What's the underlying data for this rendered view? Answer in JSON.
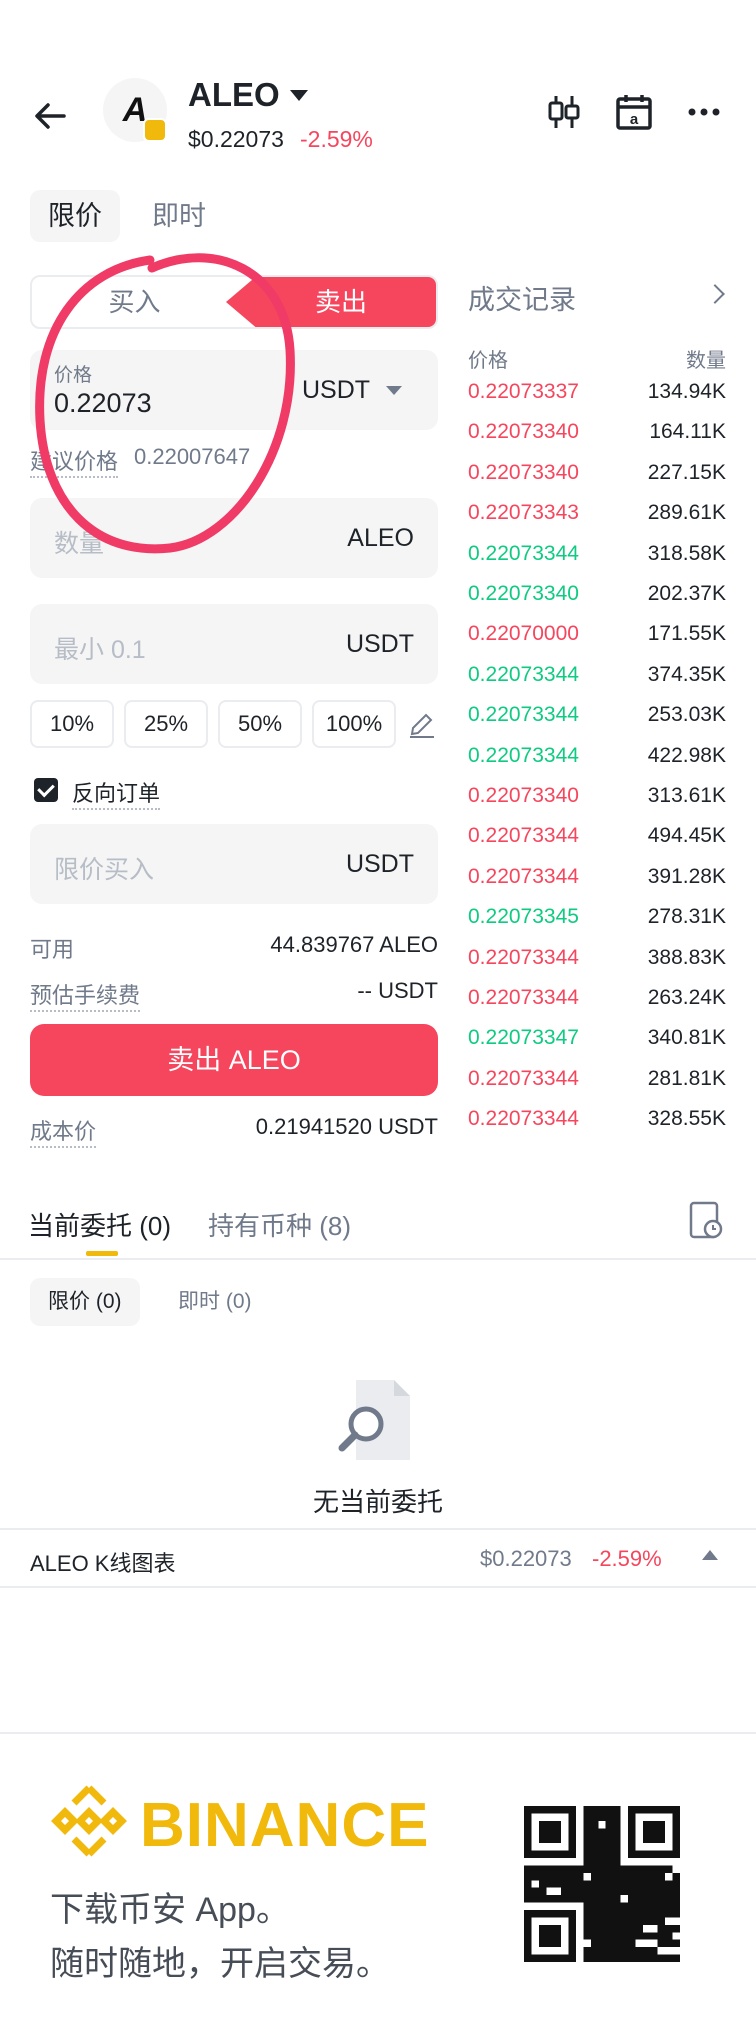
{
  "header": {
    "symbol": "ALEO",
    "price": "$0.22073",
    "change": "-2.59%",
    "coin_logo_text": "A"
  },
  "order_type_tabs": [
    "限价",
    "即时"
  ],
  "side_toggle": {
    "buy": "买入",
    "sell": "卖出"
  },
  "price_field": {
    "label": "价格",
    "value": "0.22073",
    "unit": "USDT"
  },
  "suggested_price": {
    "label": "建议价格",
    "value": "0.22007647"
  },
  "quantity_field": {
    "placeholder": "数量",
    "unit": "ALEO"
  },
  "total_field": {
    "placeholder": "最小 0.1",
    "unit": "USDT"
  },
  "percent_buttons": [
    "10%",
    "25%",
    "50%",
    "100%"
  ],
  "reverse_order": {
    "label": "反向订单",
    "checked": true
  },
  "limit_buy_field": {
    "placeholder": "限价买入",
    "unit": "USDT"
  },
  "available": {
    "label": "可用",
    "value": "44.839767 ALEO"
  },
  "estimated_fee": {
    "label": "预估手续费",
    "value": "-- USDT"
  },
  "submit_label": "卖出 ALEO",
  "cost_price": {
    "label": "成本价",
    "value": "0.21941520 USDT"
  },
  "trades": {
    "title": "成交记录",
    "col_price": "价格",
    "col_qty": "数量",
    "rows": [
      {
        "price": "0.22073337",
        "qty": "134.94K",
        "side": "sell"
      },
      {
        "price": "0.22073340",
        "qty": "164.11K",
        "side": "sell"
      },
      {
        "price": "0.22073340",
        "qty": "227.15K",
        "side": "sell"
      },
      {
        "price": "0.22073343",
        "qty": "289.61K",
        "side": "sell"
      },
      {
        "price": "0.22073344",
        "qty": "318.58K",
        "side": "buy"
      },
      {
        "price": "0.22073340",
        "qty": "202.37K",
        "side": "buy"
      },
      {
        "price": "0.22070000",
        "qty": "171.55K",
        "side": "sell"
      },
      {
        "price": "0.22073344",
        "qty": "374.35K",
        "side": "buy"
      },
      {
        "price": "0.22073344",
        "qty": "253.03K",
        "side": "buy"
      },
      {
        "price": "0.22073344",
        "qty": "422.98K",
        "side": "buy"
      },
      {
        "price": "0.22073340",
        "qty": "313.61K",
        "side": "sell"
      },
      {
        "price": "0.22073344",
        "qty": "494.45K",
        "side": "sell"
      },
      {
        "price": "0.22073344",
        "qty": "391.28K",
        "side": "sell"
      },
      {
        "price": "0.22073345",
        "qty": "278.31K",
        "side": "buy"
      },
      {
        "price": "0.22073344",
        "qty": "388.83K",
        "side": "sell"
      },
      {
        "price": "0.22073344",
        "qty": "263.24K",
        "side": "sell"
      },
      {
        "price": "0.22073347",
        "qty": "340.81K",
        "side": "buy"
      },
      {
        "price": "0.22073344",
        "qty": "281.81K",
        "side": "sell"
      },
      {
        "price": "0.22073344",
        "qty": "328.55K",
        "side": "sell"
      }
    ]
  },
  "bottom_tabs": {
    "open_orders": "当前委托 (0)",
    "holdings": "持有币种 (8)"
  },
  "sub_tabs": {
    "limit": "限价 (0)",
    "instant": "即时 (0)"
  },
  "empty_state": "无当前委托",
  "kline_bar": {
    "label": "ALEO K线图表",
    "price": "$0.22073",
    "change": "-2.59%"
  },
  "footer": {
    "brand": "BINANCE",
    "line1": "下载币安 App。",
    "line2": "随时随地，开启交易。"
  },
  "colors": {
    "red": "#f6465d",
    "green": "#0ecb81",
    "brand_yellow": "#f0b90b",
    "annotation_circle": "#ef3b66"
  }
}
